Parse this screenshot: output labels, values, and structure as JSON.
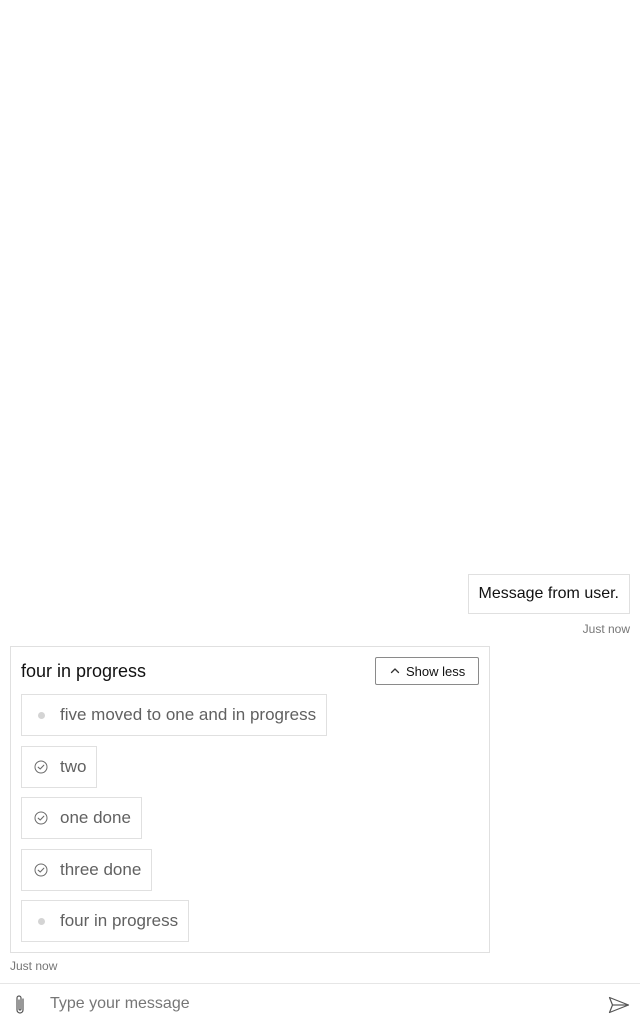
{
  "user_message": {
    "text": "Message from user.",
    "timestamp": "Just now"
  },
  "task_card": {
    "title": "four in progress",
    "toggle_label": "Show less",
    "toggle_icon": "chevron-up-icon",
    "items": [
      {
        "label": "five moved to one and in progress",
        "status": "in-progress",
        "icon": "dot-icon"
      },
      {
        "label": "two",
        "status": "done",
        "icon": "check-circle-icon"
      },
      {
        "label": "one done",
        "status": "done",
        "icon": "check-circle-icon"
      },
      {
        "label": "three done",
        "status": "done",
        "icon": "check-circle-icon"
      },
      {
        "label": "four in progress",
        "status": "in-progress",
        "icon": "dot-icon"
      }
    ],
    "timestamp": "Just now"
  },
  "composer": {
    "placeholder": "Type your message",
    "value": "",
    "attach_icon": "paperclip-icon",
    "send_icon": "send-icon"
  },
  "colors": {
    "border": "#e0e0e0",
    "item_text": "#616161",
    "timestamp": "#767676",
    "pending_dot": "#d4d4d4"
  }
}
